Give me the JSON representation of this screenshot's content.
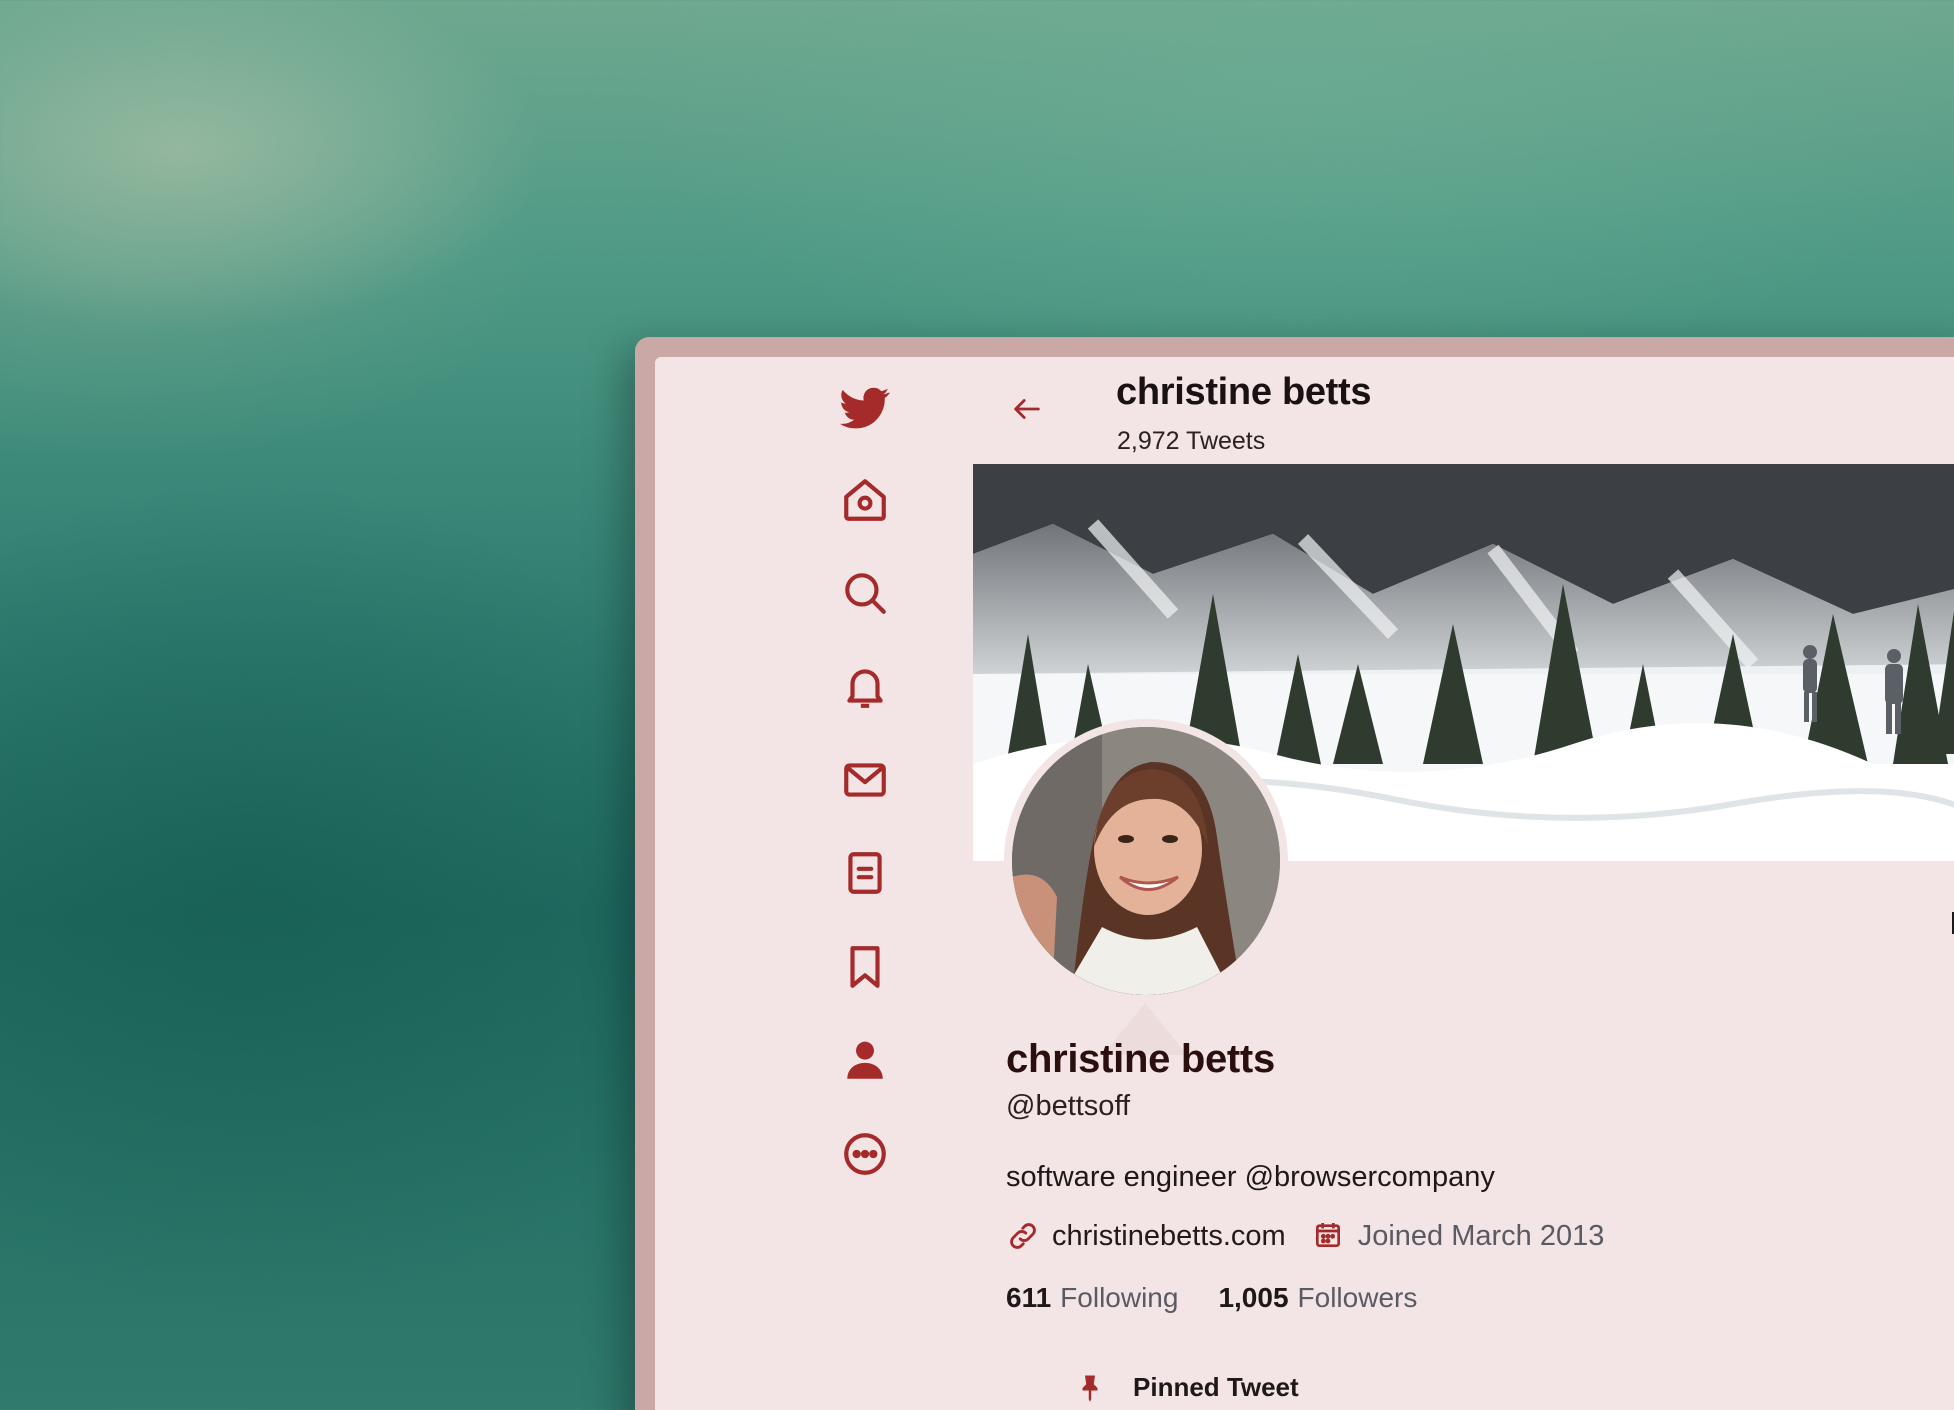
{
  "colors": {
    "accent": "#a52a2a",
    "window_bg": "#f3e5e5",
    "frame": "#c9a8a6"
  },
  "sidebar": {
    "items": [
      {
        "name": "twitter-logo-icon",
        "icon": "bird"
      },
      {
        "name": "home-icon",
        "icon": "house"
      },
      {
        "name": "search-icon",
        "icon": "magnifier"
      },
      {
        "name": "notifications-icon",
        "icon": "bell"
      },
      {
        "name": "messages-icon",
        "icon": "envelope"
      },
      {
        "name": "lists-icon",
        "icon": "document"
      },
      {
        "name": "bookmarks-icon",
        "icon": "bookmark"
      },
      {
        "name": "profile-icon",
        "icon": "person"
      },
      {
        "name": "more-icon",
        "icon": "ellipsis-circle"
      }
    ]
  },
  "header": {
    "title": "christine betts",
    "subtitle": "2,972 Tweets"
  },
  "profile": {
    "name": "christine betts",
    "handle": "@bettsoff",
    "bio": "software engineer @browsercompany",
    "website": "christinebetts.com",
    "joined": "Joined March 2013",
    "following_count": "611",
    "following_label": "Following",
    "followers_count": "1,005",
    "followers_label": "Followers"
  },
  "pinned": {
    "label": "Pinned Tweet"
  }
}
